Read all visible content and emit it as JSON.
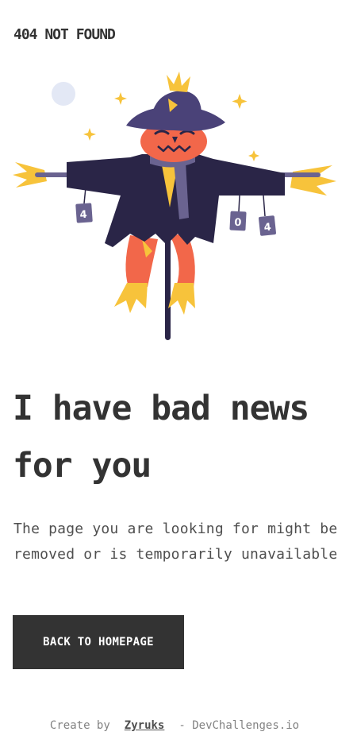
{
  "header": {
    "logo_text": "404 NOT FOUND"
  },
  "illustration": {
    "name": "scarecrow-illustration",
    "can_labels": [
      "4",
      "0",
      "4"
    ],
    "colors": {
      "hat": "#4a4278",
      "coat": "#2a2547",
      "face": "#f2674a",
      "straw": "#f7c33b",
      "scarf": "#6a6390",
      "moon": "#e3e8f5"
    }
  },
  "main": {
    "headline": "I have bad news for you",
    "description": "The page you are looking for might be removed or is temporarily unavailable",
    "cta_label": "BACK TO HOMEPAGE"
  },
  "footer": {
    "prefix": "Create by",
    "author": "Zyruks",
    "suffix": "- DevChallenges.io"
  },
  "colors": {
    "text_dark": "#333333",
    "text_muted": "#828282",
    "button_bg": "#333333",
    "button_text": "#ffffff"
  }
}
